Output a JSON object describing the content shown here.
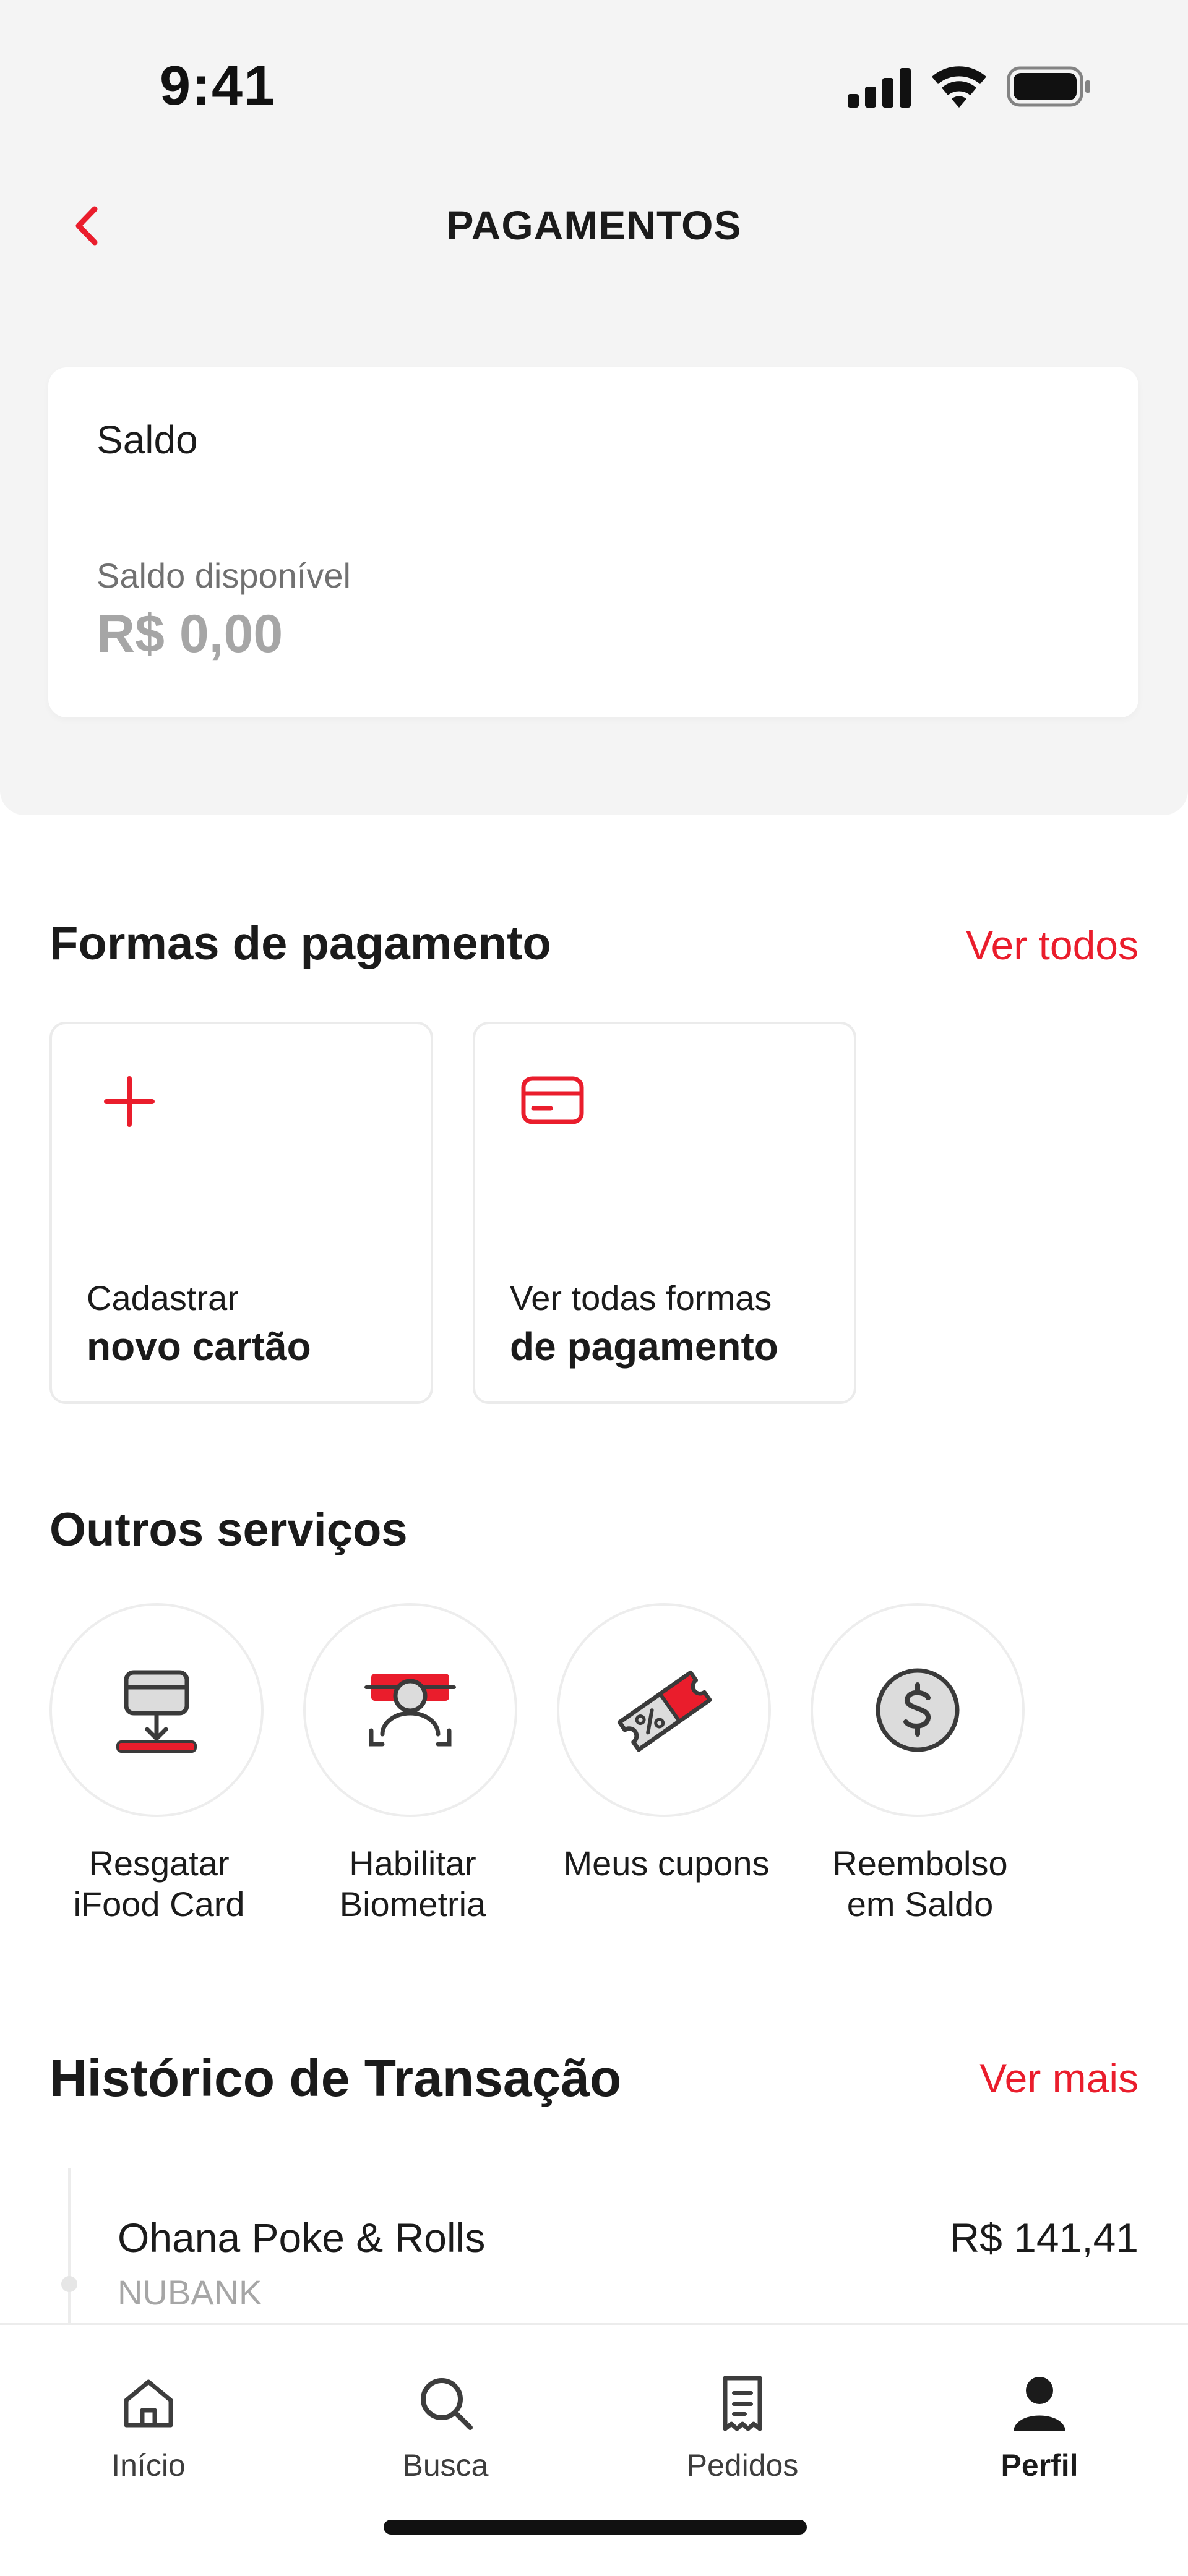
{
  "status_bar": {
    "time": "9:41"
  },
  "header": {
    "title": "PAGAMENTOS"
  },
  "saldo": {
    "title": "Saldo",
    "label": "Saldo disponível",
    "value": "R$ 0,00"
  },
  "payment_methods": {
    "title": "Formas de pagamento",
    "link": "Ver todos",
    "cards": [
      {
        "line1": "Cadastrar",
        "line2": "novo cartão",
        "icon": "plus-icon"
      },
      {
        "line1": "Ver todas formas",
        "line2": "de pagamento",
        "icon": "credit-card-icon"
      }
    ]
  },
  "other_services": {
    "title": "Outros serviços",
    "items": [
      {
        "label": "Resgatar\niFood Card",
        "icon": "gift-card-redeem-icon"
      },
      {
        "label": "Habilitar\nBiometria",
        "icon": "face-biometry-icon"
      },
      {
        "label": "Meus cupons",
        "icon": "coupon-icon"
      },
      {
        "label": "Reembolso\nem Saldo",
        "icon": "dollar-coin-icon"
      }
    ]
  },
  "history": {
    "title": "Histórico de Transação",
    "link": "Ver mais",
    "items": [
      {
        "name": "Ohana Poke & Rolls",
        "method": "NUBANK",
        "amount": "R$ 141,41"
      }
    ]
  },
  "bottom_nav": {
    "items": [
      {
        "label": "Início",
        "icon": "home-icon"
      },
      {
        "label": "Busca",
        "icon": "search-icon"
      },
      {
        "label": "Pedidos",
        "icon": "receipt-icon"
      },
      {
        "label": "Perfil",
        "icon": "user-icon"
      }
    ],
    "active": "Perfil"
  },
  "colors": {
    "accent": "#ea1d2c",
    "background": "#f4f4f4",
    "text": "#1b1b1b",
    "muted": "#a6a6a6"
  }
}
